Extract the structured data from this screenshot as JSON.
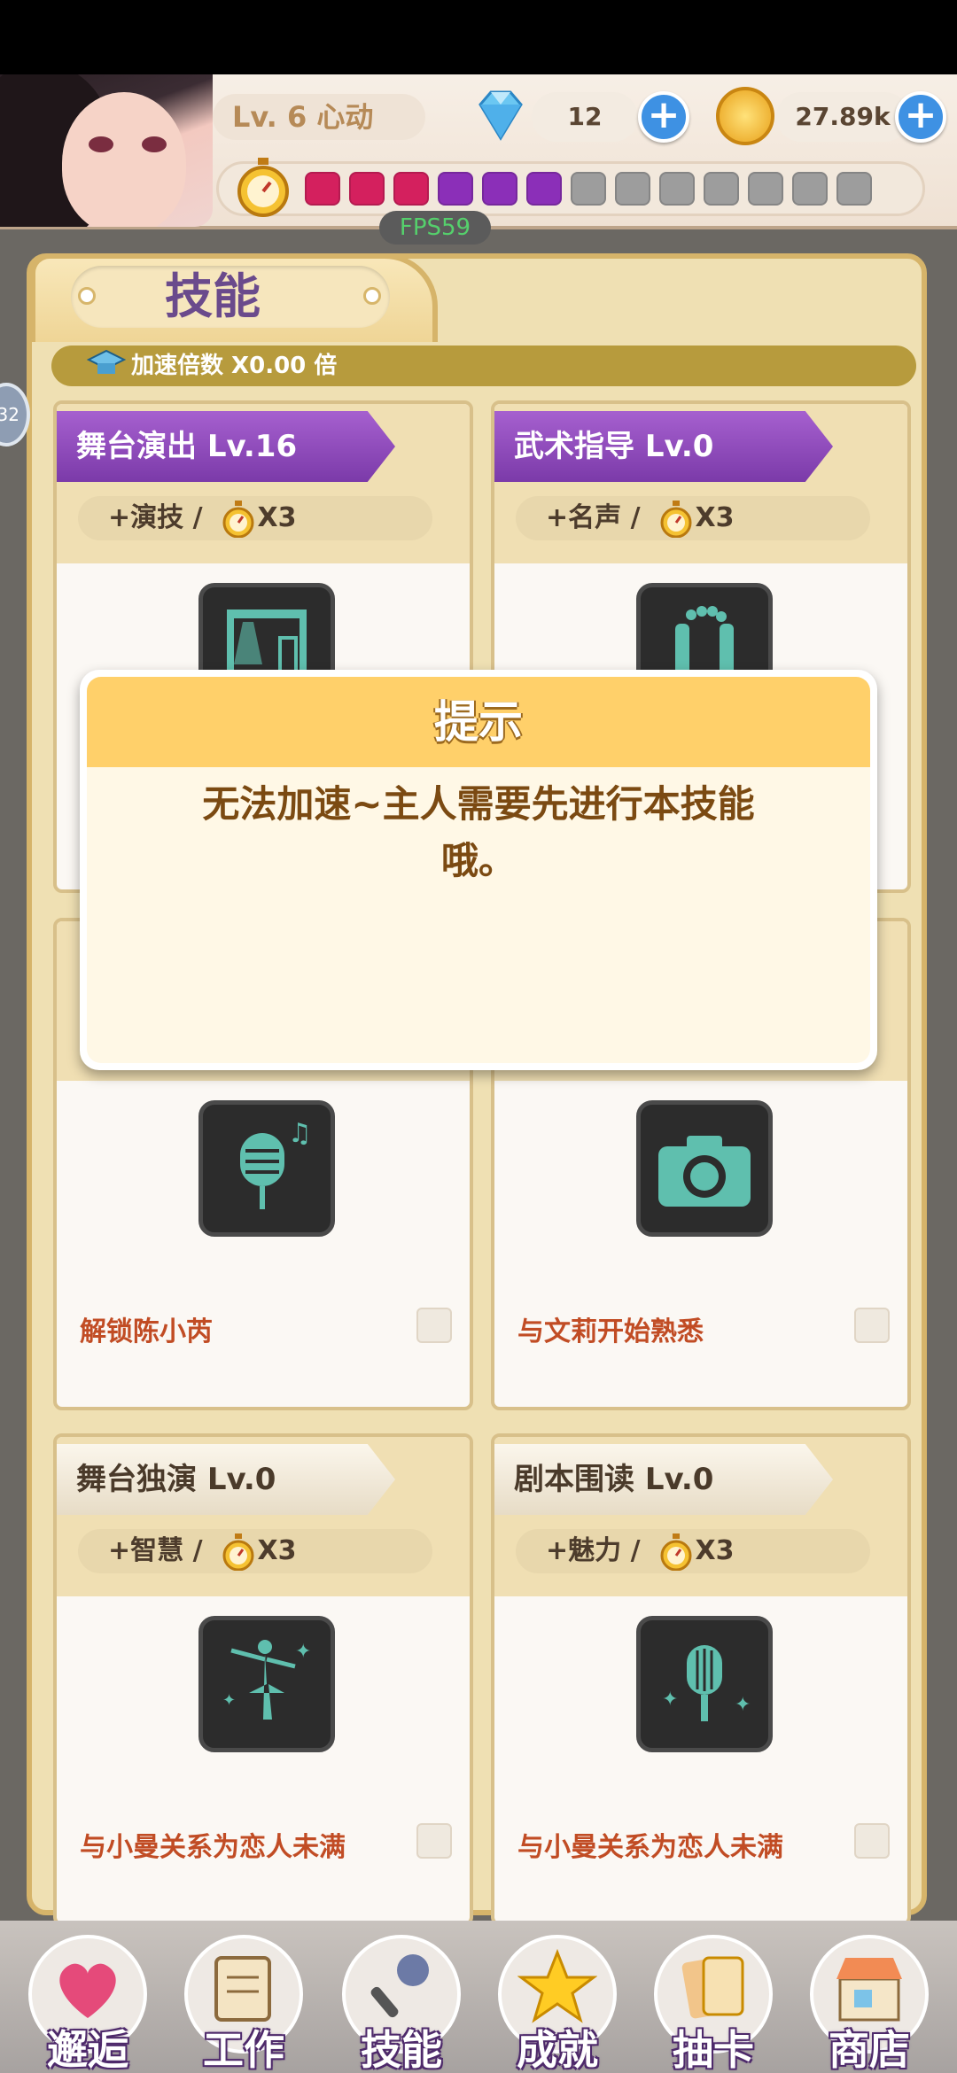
{
  "topbar": {
    "level": "Lv. 6 心动",
    "gems": "12",
    "gold": "27.89k",
    "fps": "FPS59",
    "energy_pips_filled": 6,
    "energy_pips_total": 13
  },
  "panel": {
    "title": "技能",
    "speed_text": "加速倍数 X0.00 倍",
    "side_badge": "32"
  },
  "cards": [
    {
      "title": "舞台演出 Lv.16",
      "stat": "+演技 /",
      "mult": "X3",
      "style": "purple",
      "icon": "stage-icon",
      "unlock": ""
    },
    {
      "title": "武术指导 Lv.0",
      "stat": "+名声 /",
      "mult": "X3",
      "style": "purple",
      "icon": "nunchaku-icon",
      "unlock": ""
    },
    {
      "title": "",
      "stat": "",
      "mult": "",
      "style": "grey",
      "icon": "microphone-note-icon",
      "unlock": "解锁陈小芮"
    },
    {
      "title": "",
      "stat": "",
      "mult": "",
      "style": "grey",
      "icon": "camera-icon",
      "unlock": "与文莉开始熟悉"
    },
    {
      "title": "舞台独演 Lv.0",
      "stat": "+智慧 /",
      "mult": "X3",
      "style": "grey",
      "icon": "ballerina-icon",
      "unlock": "与小曼关系为恋人未满"
    },
    {
      "title": "剧本围读 Lv.0",
      "stat": "+魅力 /",
      "mult": "X3",
      "style": "grey",
      "icon": "retro-microphone-icon",
      "unlock": "与小曼关系为恋人未满"
    }
  ],
  "modal": {
    "title": "提示",
    "message": "无法加速~主人需要先进行本技能哦。"
  },
  "nav": [
    {
      "label": "邂逅",
      "icon": "hearts-icon"
    },
    {
      "label": "工作",
      "icon": "notebook-icon"
    },
    {
      "label": "技能",
      "icon": "microphone-icon"
    },
    {
      "label": "成就",
      "icon": "star-icon"
    },
    {
      "label": "抽卡",
      "icon": "cards-icon"
    },
    {
      "label": "商店",
      "icon": "shop-icon"
    }
  ],
  "colors": {
    "accent_purple": "#8b45b8",
    "gold": "#d6b46a",
    "modal_header": "#ffd06a"
  }
}
